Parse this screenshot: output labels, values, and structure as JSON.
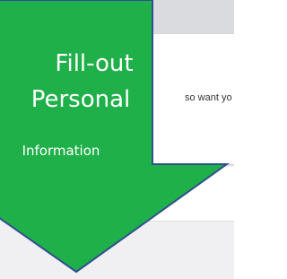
{
  "panel": {
    "partial_text": "so want yo"
  },
  "callout": {
    "line1": "Fill-out",
    "line2": "Personal",
    "line3": "Information",
    "fill_color": "#1fb04a",
    "stroke_color": "#2f4f8f"
  }
}
